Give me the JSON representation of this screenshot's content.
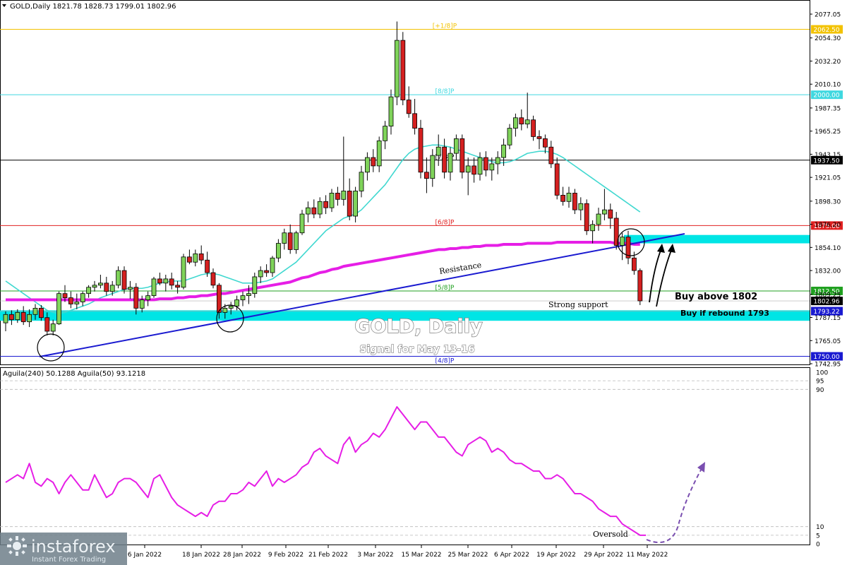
{
  "header": {
    "symbol_line": "GOLD,Daily  1821.78 1828.73 1799.01 1802.96"
  },
  "indicator_header": "Aguila(240) 50.1288  Aguila(50) 93.1218",
  "title": "GOLD, Daily",
  "subtitle": "Signal for May 13-16",
  "annotations": {
    "resistance": "Resistance",
    "strong_support": "Strong support",
    "buy_above": "Buy above 1802",
    "buy_rebound": "Buy if rebound 1793",
    "oversold": "Oversold"
  },
  "brand": {
    "name": "instaforex",
    "tagline": "Instant Forex Trading"
  },
  "colors": {
    "bull": "#7fd35a",
    "bear": "#d42020",
    "ma_slow": "#e61ee6",
    "ma_fast": "#40d8d0",
    "trendline": "#1a1ad0",
    "zone": "#00e5e5",
    "oscillator": "#e61ee6",
    "arrow_projection": "#7a4fb0"
  },
  "chart_data": [
    {
      "type": "candlestick",
      "title": "GOLD, Daily",
      "x_tick_labels": [
        "6 Jan 2022",
        "18 Jan 2022",
        "28 Jan 2022",
        "9 Feb 2022",
        "21 Feb 2022",
        "3 Mar 2022",
        "15 Mar 2022",
        "25 Mar 2022",
        "6 Apr 2022",
        "19 Apr 2022",
        "29 Apr 2022",
        "11 May 2022"
      ],
      "y_tick_labels": [
        "2077.05",
        "2054.30",
        "2032.20",
        "2010.10",
        "1987.35",
        "1965.25",
        "1943.15",
        "1921.05",
        "1898.30",
        "1876.20",
        "1854.10",
        "1832.00",
        "1809.25",
        "1787.15",
        "1765.05",
        "1742.95"
      ],
      "ylim": [
        1740,
        2085
      ],
      "price_tags": [
        {
          "value": "2062.50",
          "color": "#f2c200",
          "level_label": "[+1/8]P"
        },
        {
          "value": "2000.00",
          "color": "#40d8e0",
          "level_label": "[8/8]P"
        },
        {
          "value": "1937.50",
          "color": "#000000",
          "level_label": "[7/8]P"
        },
        {
          "value": "1875.00",
          "color": "#e02020",
          "level_label": "[6/8]P"
        },
        {
          "value": "1812.50",
          "color": "#20a020",
          "level_label": "[5/8]P"
        },
        {
          "value": "1802.96",
          "color": "#000000",
          "level_label": ""
        },
        {
          "value": "1793.22",
          "color": "#1a1ad0",
          "level_label": ""
        },
        {
          "value": "1750.00",
          "color": "#1a1ad0",
          "level_label": "[4/8]P"
        }
      ],
      "zones": [
        {
          "name": "resistance-zone",
          "from": 1858,
          "to": 1866
        },
        {
          "name": "support-zone",
          "from": 1784,
          "to": 1794
        }
      ],
      "trendline": {
        "from": [
          0,
          1750
        ],
        "to": [
          120,
          1866
        ]
      },
      "candles": [
        [
          1782,
          1793,
          1774,
          1790
        ],
        [
          1790,
          1794,
          1780,
          1785
        ],
        [
          1785,
          1795,
          1782,
          1792
        ],
        [
          1792,
          1798,
          1780,
          1783
        ],
        [
          1783,
          1795,
          1778,
          1790
        ],
        [
          1790,
          1800,
          1785,
          1796
        ],
        [
          1796,
          1799,
          1784,
          1787
        ],
        [
          1787,
          1792,
          1770,
          1774
        ],
        [
          1774,
          1785,
          1770,
          1781
        ],
        [
          1781,
          1812,
          1780,
          1810
        ],
        [
          1810,
          1818,
          1802,
          1806
        ],
        [
          1806,
          1812,
          1796,
          1800
        ],
        [
          1800,
          1810,
          1795,
          1802
        ],
        [
          1802,
          1812,
          1798,
          1810
        ],
        [
          1810,
          1818,
          1806,
          1816
        ],
        [
          1816,
          1822,
          1812,
          1818
        ],
        [
          1818,
          1828,
          1815,
          1820
        ],
        [
          1820,
          1826,
          1808,
          1812
        ],
        [
          1812,
          1822,
          1808,
          1818
        ],
        [
          1818,
          1836,
          1815,
          1832
        ],
        [
          1832,
          1836,
          1810,
          1814
        ],
        [
          1814,
          1822,
          1805,
          1816
        ],
        [
          1816,
          1820,
          1790,
          1796
        ],
        [
          1796,
          1808,
          1792,
          1804
        ],
        [
          1804,
          1812,
          1798,
          1808
        ],
        [
          1808,
          1826,
          1806,
          1824
        ],
        [
          1824,
          1830,
          1818,
          1820
        ],
        [
          1820,
          1828,
          1812,
          1824
        ],
        [
          1824,
          1830,
          1814,
          1818
        ],
        [
          1818,
          1822,
          1810,
          1816
        ],
        [
          1816,
          1848,
          1814,
          1845
        ],
        [
          1845,
          1852,
          1838,
          1840
        ],
        [
          1840,
          1852,
          1836,
          1848
        ],
        [
          1848,
          1856,
          1838,
          1842
        ],
        [
          1842,
          1850,
          1826,
          1830
        ],
        [
          1830,
          1834,
          1815,
          1818
        ],
        [
          1818,
          1820,
          1786,
          1792
        ],
        [
          1792,
          1800,
          1786,
          1796
        ],
        [
          1796,
          1802,
          1790,
          1798
        ],
        [
          1798,
          1808,
          1794,
          1804
        ],
        [
          1804,
          1812,
          1798,
          1808
        ],
        [
          1808,
          1818,
          1800,
          1810
        ],
        [
          1810,
          1830,
          1806,
          1826
        ],
        [
          1826,
          1836,
          1820,
          1832
        ],
        [
          1832,
          1838,
          1826,
          1830
        ],
        [
          1830,
          1846,
          1826,
          1844
        ],
        [
          1844,
          1862,
          1840,
          1858
        ],
        [
          1858,
          1872,
          1852,
          1868
        ],
        [
          1868,
          1876,
          1848,
          1852
        ],
        [
          1852,
          1870,
          1848,
          1868
        ],
        [
          1868,
          1890,
          1866,
          1886
        ],
        [
          1886,
          1898,
          1878,
          1892
        ],
        [
          1892,
          1900,
          1882,
          1886
        ],
        [
          1886,
          1902,
          1882,
          1898
        ],
        [
          1898,
          1904,
          1886,
          1892
        ],
        [
          1892,
          1910,
          1888,
          1906
        ],
        [
          1906,
          1912,
          1894,
          1900
        ],
        [
          1900,
          1960,
          1894,
          1908
        ],
        [
          1908,
          1920,
          1880,
          1884
        ],
        [
          1884,
          1912,
          1878,
          1908
        ],
        [
          1908,
          1932,
          1902,
          1926
        ],
        [
          1926,
          1945,
          1918,
          1940
        ],
        [
          1940,
          1948,
          1926,
          1932
        ],
        [
          1932,
          1960,
          1926,
          1956
        ],
        [
          1956,
          1975,
          1948,
          1970
        ],
        [
          1970,
          2005,
          1962,
          1998
        ],
        [
          1998,
          2070,
          1990,
          2052
        ],
        [
          2052,
          2060,
          1990,
          1995
        ],
        [
          1995,
          2008,
          1978,
          1982
        ],
        [
          1982,
          1996,
          1962,
          1968
        ],
        [
          1968,
          1976,
          1920,
          1926
        ],
        [
          1926,
          1940,
          1906,
          1920
        ],
        [
          1920,
          1948,
          1912,
          1942
        ],
        [
          1942,
          1962,
          1932,
          1950
        ],
        [
          1950,
          1958,
          1920,
          1926
        ],
        [
          1926,
          1950,
          1918,
          1944
        ],
        [
          1944,
          1962,
          1938,
          1958
        ],
        [
          1958,
          1962,
          1920,
          1926
        ],
        [
          1926,
          1940,
          1904,
          1932
        ],
        [
          1932,
          1940,
          1916,
          1924
        ],
        [
          1924,
          1945,
          1918,
          1940
        ],
        [
          1940,
          1946,
          1922,
          1928
        ],
        [
          1928,
          1940,
          1918,
          1934
        ],
        [
          1934,
          1946,
          1924,
          1940
        ],
        [
          1940,
          1958,
          1932,
          1952
        ],
        [
          1952,
          1972,
          1948,
          1968
        ],
        [
          1968,
          1982,
          1960,
          1978
        ],
        [
          1978,
          1986,
          1966,
          1972
        ],
        [
          1972,
          2002,
          1968,
          1976
        ],
        [
          1976,
          1980,
          1956,
          1960
        ],
        [
          1960,
          1966,
          1948,
          1958
        ],
        [
          1958,
          1962,
          1944,
          1950
        ],
        [
          1950,
          1956,
          1930,
          1934
        ],
        [
          1934,
          1940,
          1900,
          1904
        ],
        [
          1904,
          1912,
          1894,
          1898
        ],
        [
          1898,
          1912,
          1892,
          1906
        ],
        [
          1906,
          1910,
          1886,
          1890
        ],
        [
          1890,
          1902,
          1880,
          1896
        ],
        [
          1896,
          1900,
          1866,
          1870
        ],
        [
          1870,
          1880,
          1858,
          1876
        ],
        [
          1876,
          1892,
          1870,
          1886
        ],
        [
          1886,
          1910,
          1880,
          1890
        ],
        [
          1890,
          1896,
          1872,
          1882
        ],
        [
          1882,
          1888,
          1852,
          1856
        ],
        [
          1856,
          1868,
          1842,
          1864
        ],
        [
          1864,
          1870,
          1838,
          1844
        ],
        [
          1844,
          1850,
          1828,
          1832
        ],
        [
          1832,
          1834,
          1799,
          1803
        ]
      ],
      "moving_averages": [
        {
          "name": "MA fast",
          "color": "#40d8d0",
          "values": [
            1822,
            1818,
            1814,
            1810,
            1806,
            1802,
            1798,
            1794,
            1792,
            1791,
            1792,
            1794,
            1796,
            1798,
            1800,
            1803,
            1806,
            1808,
            1810,
            1812,
            1814,
            1815,
            1815,
            1815,
            1816,
            1818,
            1820,
            1821,
            1822,
            1822,
            1822,
            1824,
            1826,
            1828,
            1829,
            1829,
            1828,
            1826,
            1824,
            1822,
            1820,
            1820,
            1820,
            1821,
            1822,
            1824,
            1828,
            1832,
            1836,
            1840,
            1846,
            1852,
            1858,
            1864,
            1870,
            1874,
            1878,
            1882,
            1884,
            1886,
            1890,
            1896,
            1902,
            1908,
            1914,
            1922,
            1930,
            1938,
            1944,
            1948,
            1950,
            1951,
            1952,
            1952,
            1951,
            1950,
            1948,
            1946,
            1944,
            1942,
            1940,
            1938,
            1936,
            1935,
            1935,
            1936,
            1938,
            1941,
            1944,
            1945,
            1946,
            1946,
            1945,
            1943,
            1940,
            1936,
            1932,
            1928,
            1924,
            1920,
            1916,
            1912,
            1908,
            1904,
            1900,
            1896,
            1892,
            1888
          ]
        },
        {
          "name": "MA slow",
          "color": "#e61ee6",
          "values": [
            1804,
            1804,
            1804,
            1804,
            1804,
            1804,
            1804,
            1804,
            1804,
            1804,
            1804,
            1804,
            1804,
            1804,
            1804,
            1804,
            1804,
            1804,
            1804,
            1804,
            1804,
            1804,
            1804,
            1804,
            1804,
            1804,
            1805,
            1805,
            1805,
            1806,
            1806,
            1807,
            1807,
            1808,
            1808,
            1809,
            1810,
            1810,
            1811,
            1812,
            1813,
            1814,
            1815,
            1816,
            1817,
            1818,
            1819,
            1820,
            1821,
            1823,
            1825,
            1826,
            1828,
            1830,
            1831,
            1833,
            1834,
            1836,
            1837,
            1838,
            1839,
            1840,
            1841,
            1842,
            1843,
            1844,
            1845,
            1846,
            1847,
            1848,
            1849,
            1850,
            1851,
            1852,
            1852,
            1853,
            1853,
            1854,
            1854,
            1855,
            1855,
            1856,
            1856,
            1856,
            1857,
            1857,
            1857,
            1857,
            1858,
            1858,
            1858,
            1858,
            1858,
            1859,
            1859,
            1859,
            1859,
            1859,
            1859,
            1859,
            1859,
            1859,
            1859,
            1858,
            1858,
            1858,
            1857,
            1857
          ]
        }
      ]
    },
    {
      "type": "line",
      "title": "Aguila(240) 50.1288  Aguila(50) 93.1218",
      "y_tick_labels": [
        "100",
        "95",
        "90",
        "10",
        "5",
        "0"
      ],
      "ylim": [
        0,
        100
      ],
      "reference_levels": [
        95,
        90,
        10,
        5
      ],
      "series": [
        {
          "name": "Aguila(50)",
          "values": [
            14,
            15,
            16,
            15,
            19,
            14,
            13,
            15,
            14,
            11,
            14,
            16,
            14,
            12,
            12,
            16,
            13,
            10,
            11,
            14,
            15,
            15,
            14,
            12,
            10,
            15,
            16,
            13,
            10,
            8,
            7,
            6,
            5,
            6,
            5,
            8,
            9,
            9,
            11,
            11,
            12,
            14,
            13,
            15,
            17,
            13,
            15,
            14,
            15,
            16,
            18,
            19,
            22,
            23,
            21,
            20,
            19,
            24,
            26,
            22,
            24,
            25,
            27,
            26,
            28,
            31,
            34,
            32,
            30,
            28,
            30,
            30,
            28,
            26,
            26,
            24,
            22,
            21,
            24,
            25,
            26,
            25,
            22,
            23,
            22,
            20,
            19,
            19,
            18,
            17,
            17,
            15,
            15,
            16,
            15,
            13,
            11,
            11,
            10,
            9,
            7,
            6,
            5,
            5,
            3,
            2,
            1,
            0,
            0
          ]
        }
      ],
      "projection": {
        "from": [
          109,
          2
        ],
        "to": [
          122,
          18
        ]
      }
    }
  ]
}
